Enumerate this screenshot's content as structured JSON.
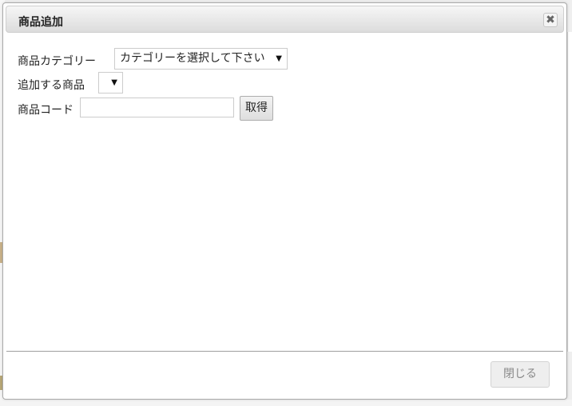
{
  "dialog": {
    "title": "商品追加",
    "close_glyph": "✖"
  },
  "form": {
    "category_label": "商品カテゴリー",
    "category_selected": "カテゴリーを選択して下さい",
    "product_label": "追加する商品",
    "product_selected": "",
    "code_label": "商品コード",
    "code_value": "",
    "fetch_button": "取得"
  },
  "footer": {
    "close_button": "閉じる"
  },
  "icons": {
    "close": "close-icon",
    "dropdown": "chevron-down-icon"
  },
  "colors": {
    "title_bar": "#e2e2e2",
    "border": "#aaaaaa"
  }
}
